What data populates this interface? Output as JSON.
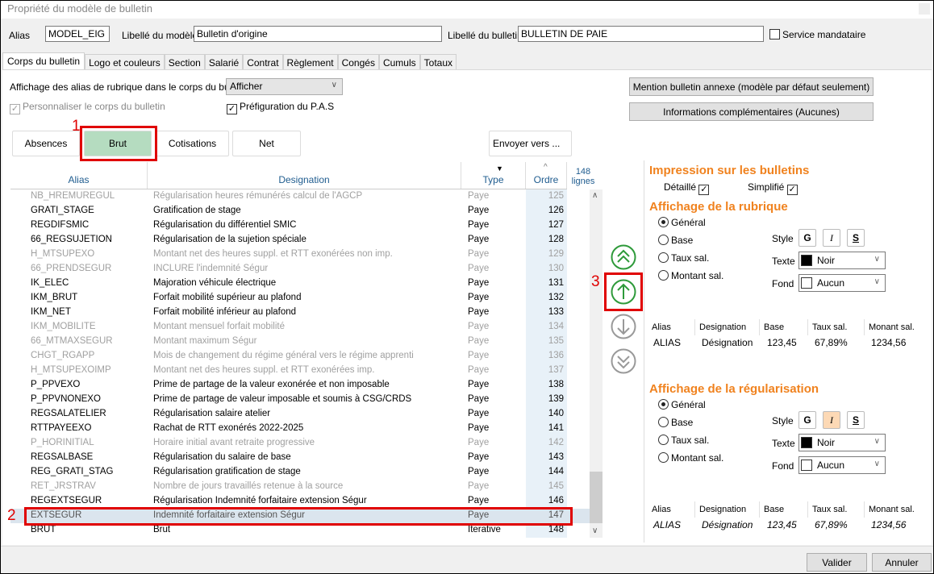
{
  "window": {
    "title": "Propriété du modèle de bulletin"
  },
  "header": {
    "alias_label": "Alias",
    "alias_value": "MODEL_EIG",
    "libelle_modele_label": "Libellé du modèle",
    "libelle_modele_value": "Bulletin d'origine",
    "libelle_bulletin_label": "Libellé du bulletin",
    "libelle_bulletin_value": "BULLETIN DE PAIE",
    "service_mandataire": "Service mandataire",
    "service_mandataire_checked": false
  },
  "tabs": [
    {
      "label": "Corps du bulletin",
      "active": true
    },
    {
      "label": "Logo et couleurs"
    },
    {
      "label": "Section"
    },
    {
      "label": "Salarié"
    },
    {
      "label": "Contrat"
    },
    {
      "label": "Règlement"
    },
    {
      "label": "Congés"
    },
    {
      "label": "Cumuls"
    },
    {
      "label": "Totaux"
    }
  ],
  "options": {
    "affichage_label": "Affichage des alias de rubrique dans le corps du bulletin",
    "affichage_value": "Afficher",
    "personnaliser": "Personnaliser le corps du bulletin",
    "prefiguration": "Préfiguration du P.A.S",
    "mention_button": "Mention bulletin annexe (modèle par défaut seulement)",
    "infos_button": "Informations complémentaires (Aucunes)"
  },
  "categories": [
    {
      "label": "Absences"
    },
    {
      "label": "Brut",
      "active": true
    },
    {
      "label": "Cotisations"
    },
    {
      "label": "Net"
    }
  ],
  "send_to": "Envoyer vers ...",
  "annotations": [
    "1",
    "2",
    "3"
  ],
  "table": {
    "columns": [
      "Alias",
      "Designation",
      "Type",
      "Ordre"
    ],
    "count": "148",
    "count_unit": "lignes",
    "rows": [
      {
        "alias": "NB_HREMUREGUL",
        "designation": "Régularisation heures rémunérés calcul de l'AGCP",
        "type": "Paye",
        "ordre": "125",
        "dim": true
      },
      {
        "alias": "GRATI_STAGE",
        "designation": "Gratification de stage",
        "type": "Paye",
        "ordre": "126"
      },
      {
        "alias": "REGDIFSMIC",
        "designation": "Régularisation du différentiel SMIC",
        "type": "Paye",
        "ordre": "127"
      },
      {
        "alias": "66_REGSUJETION",
        "designation": "Régularisation de la sujetion spéciale",
        "type": "Paye",
        "ordre": "128"
      },
      {
        "alias": "H_MTSUPEXO",
        "designation": "Montant net des heures suppl. et RTT exonérées non imp.",
        "type": "Paye",
        "ordre": "129",
        "dim": true
      },
      {
        "alias": "66_PRENDSEGUR",
        "designation": "INCLURE l'indemnité Ségur",
        "type": "Paye",
        "ordre": "130",
        "dim": true
      },
      {
        "alias": "IK_ELEC",
        "designation": "Majoration véhicule électrique",
        "type": "Paye",
        "ordre": "131"
      },
      {
        "alias": "IKM_BRUT",
        "designation": "Forfait mobilité supérieur au plafond",
        "type": "Paye",
        "ordre": "132"
      },
      {
        "alias": "IKM_NET",
        "designation": "Forfait mobilité inférieur au plafond",
        "type": "Paye",
        "ordre": "133"
      },
      {
        "alias": "IKM_MOBILITE",
        "designation": "Montant mensuel forfait mobilité",
        "type": "Paye",
        "ordre": "134",
        "dim": true
      },
      {
        "alias": "66_MTMAXSEGUR",
        "designation": "Montant maximum Ségur",
        "type": "Paye",
        "ordre": "135",
        "dim": true
      },
      {
        "alias": "CHGT_RGAPP",
        "designation": "Mois de changement du régime général vers le régime apprenti",
        "type": "Paye",
        "ordre": "136",
        "dim": true
      },
      {
        "alias": "H_MTSUPEXOIMP",
        "designation": "Montant net des heures suppl. et RTT exonérées imp.",
        "type": "Paye",
        "ordre": "137",
        "dim": true
      },
      {
        "alias": "P_PPVEXO",
        "designation": "Prime de partage de la valeur exonérée et non imposable",
        "type": "Paye",
        "ordre": "138"
      },
      {
        "alias": "P_PPVNONEXO",
        "designation": "Prime de partage de valeur imposable et soumis à CSG/CRDS",
        "type": "Paye",
        "ordre": "139"
      },
      {
        "alias": "REGSALATELIER",
        "designation": "Régularisation salaire atelier",
        "type": "Paye",
        "ordre": "140"
      },
      {
        "alias": "RTTPAYEEXO",
        "designation": "Rachat de RTT exonérés 2022-2025",
        "type": "Paye",
        "ordre": "141"
      },
      {
        "alias": "P_HORINITIAL",
        "designation": "Horaire initial avant retraite progressive",
        "type": "Paye",
        "ordre": "142",
        "dim": true
      },
      {
        "alias": "REGSALBASE",
        "designation": "Régularisation du salaire de base",
        "type": "Paye",
        "ordre": "143"
      },
      {
        "alias": "REG_GRATI_STAG",
        "designation": "Régularisation gratification de stage",
        "type": "Paye",
        "ordre": "144"
      },
      {
        "alias": "RET_JRSTRAV",
        "designation": "Nombre de jours travaillés retenue à la source",
        "type": "Paye",
        "ordre": "145",
        "dim": true
      },
      {
        "alias": "REGEXTSEGUR",
        "designation": "Régularisation Indemnité forfaitaire extension Ségur",
        "type": "Paye",
        "ordre": "146"
      },
      {
        "alias": "EXTSEGUR",
        "designation": "Indemnité forfaitaire extension Ségur",
        "type": "Paye",
        "ordre": "147",
        "selected": true
      },
      {
        "alias": "BRUT",
        "designation": "Brut",
        "type": "Iterative",
        "ordre": "148"
      }
    ]
  },
  "move_icons": [
    "move-top-icon",
    "move-up-icon",
    "move-down-icon",
    "move-bottom-icon"
  ],
  "impression": {
    "title": "Impression sur les bulletins",
    "detaille": "Détaillé",
    "simplifie": "Simplifié",
    "detaille_checked": true,
    "simplifie_checked": true
  },
  "rubrique": {
    "title": "Affichage de la rubrique",
    "radios": [
      "Général",
      "Base",
      "Taux sal.",
      "Montant sal."
    ],
    "selected": "Général",
    "style_label": "Style",
    "style_buttons": [
      "G",
      "I",
      "S"
    ],
    "italic_active": false,
    "texte_label": "Texte",
    "texte_value": "Noir",
    "fond_label": "Fond",
    "fond_value": "Aucun",
    "preview_headers": [
      "Alias",
      "Designation",
      "Base",
      "Taux sal.",
      "Monant sal."
    ],
    "preview_values": [
      "ALIAS",
      "Désignation",
      "123,45",
      "67,89%",
      "1234,56"
    ]
  },
  "regularisation": {
    "title": "Affichage de la régularisation",
    "radios": [
      "Général",
      "Base",
      "Taux sal.",
      "Montant sal."
    ],
    "selected": "Général",
    "style_label": "Style",
    "style_buttons": [
      "G",
      "I",
      "S"
    ],
    "italic_active": true,
    "texte_label": "Texte",
    "texte_value": "Noir",
    "fond_label": "Fond",
    "fond_value": "Aucun",
    "preview_headers": [
      "Alias",
      "Designation",
      "Base",
      "Taux sal.",
      "Monant sal."
    ],
    "preview_values": [
      "ALIAS",
      "Désignation",
      "123,45",
      "67,89%",
      "1234,56"
    ]
  },
  "colors": {
    "accent_orange": "#f0821e",
    "active_category": "#b5dcc0",
    "move_green": "#2e9a3a",
    "annotation_red": "#e00000",
    "header_blue": "#1f5c8f"
  },
  "footer": {
    "validate": "Valider",
    "cancel": "Annuler"
  }
}
